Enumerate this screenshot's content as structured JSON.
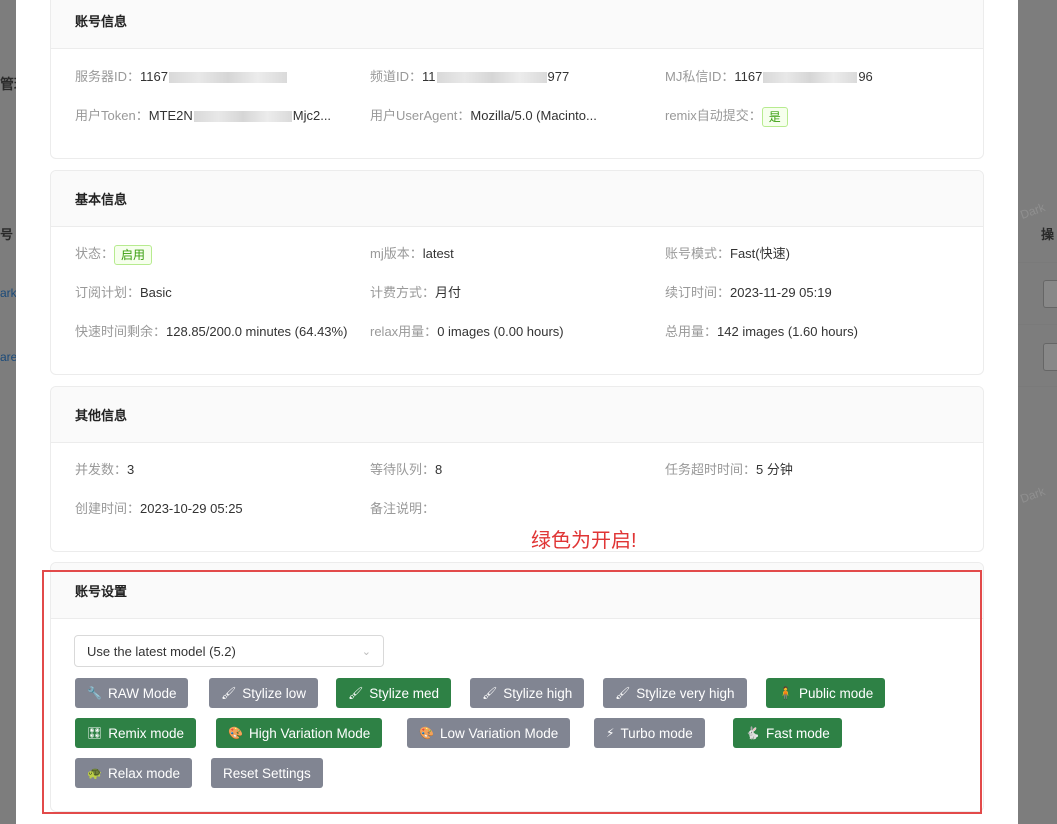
{
  "background": {
    "frag_title": "管理",
    "frag_col_header": "号",
    "frag_action_header": "操",
    "frag_link_1": "ark",
    "frag_link_2": "are",
    "watermark_1": "Dark",
    "watermark_2": "Dark"
  },
  "account_info": {
    "title": "账号信息",
    "server_id_label": "服务器ID：",
    "server_id_prefix": "1167",
    "channel_id_label": "频道ID：",
    "channel_id_prefix": "11",
    "channel_id_suffix": "977",
    "mj_dm_label": "MJ私信ID：",
    "mj_dm_prefix": "1167",
    "mj_dm_suffix": "96",
    "token_label": "用户Token：",
    "token_prefix": "MTE2N",
    "token_suffix": "Mjc2...",
    "ua_label": "用户UserAgent：",
    "ua_value": "Mozilla/5.0 (Macinto...",
    "remix_label": "remix自动提交：",
    "remix_value": "是"
  },
  "basic_info": {
    "title": "基本信息",
    "status_label": "状态：",
    "status_value": "启用",
    "mj_version_label": "mj版本：",
    "mj_version_value": "latest",
    "account_mode_label": "账号模式：",
    "account_mode_value": "Fast(快速)",
    "plan_label": "订阅计划：",
    "plan_value": "Basic",
    "billing_label": "计费方式：",
    "billing_value": "月付",
    "renew_label": "续订时间：",
    "renew_value": "2023-11-29 05:19",
    "fast_left_label": "快速时间剩余：",
    "fast_left_value": "128.85/200.0 minutes (64.43%)",
    "relax_label": "relax用量：",
    "relax_value": "0 images (0.00 hours)",
    "total_label": "总用量：",
    "total_value": "142 images (1.60 hours)"
  },
  "other_info": {
    "title": "其他信息",
    "concurrency_label": "并发数：",
    "concurrency_value": "3",
    "queue_label": "等待队列：",
    "queue_value": "8",
    "timeout_label": "任务超时时间：",
    "timeout_value": "5 分钟",
    "created_label": "创建时间：",
    "created_value": "2023-10-29 05:25",
    "remark_label": "备注说明：",
    "remark_value": ""
  },
  "annotation_note": "绿色为开启!",
  "settings": {
    "title": "账号设置",
    "model_select_value": "Use the latest model (5.2)",
    "buttons": [
      {
        "label": "RAW Mode",
        "icon": "🔧",
        "state": "off"
      },
      {
        "label": "Stylize low",
        "icon": "🖌",
        "state": "off"
      },
      {
        "label": "Stylize med",
        "icon": "🖌",
        "state": "on"
      },
      {
        "label": "Stylize high",
        "icon": "🖌",
        "state": "off"
      },
      {
        "label": "Stylize very high",
        "icon": "🖌",
        "state": "off"
      },
      {
        "label": "Public mode",
        "icon": "🧍",
        "state": "on"
      },
      {
        "label": "Remix mode",
        "icon": "🎛",
        "state": "on"
      },
      {
        "label": "High Variation Mode",
        "icon": "🎨",
        "state": "on"
      },
      {
        "label": "Low Variation Mode",
        "icon": "🎨",
        "state": "off"
      },
      {
        "label": "Turbo mode",
        "icon": "⚡",
        "state": "off"
      },
      {
        "label": "Fast mode",
        "icon": "🐇",
        "state": "on"
      },
      {
        "label": "Relax mode",
        "icon": "🐢",
        "state": "off"
      },
      {
        "label": "Reset Settings",
        "icon": "",
        "state": "off"
      }
    ]
  },
  "colors": {
    "toggle_on": "#2e8145",
    "toggle_off": "#818592",
    "highlight_frame": "#e24a4a",
    "note_text": "#e03535"
  }
}
